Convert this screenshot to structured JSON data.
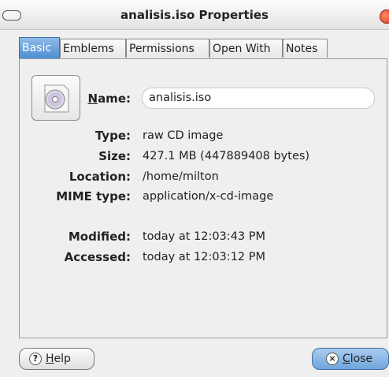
{
  "window": {
    "title": "analisis.iso Properties"
  },
  "tabs": [
    {
      "label": "Basic"
    },
    {
      "label": "Emblems"
    },
    {
      "label": "Permissions"
    },
    {
      "label": "Open With"
    },
    {
      "label": "Notes"
    }
  ],
  "basic": {
    "name_label": "Name:",
    "name_value": "analisis.iso",
    "type_label": "Type:",
    "type_value": "raw CD image",
    "size_label": "Size:",
    "size_value": "427.1 MB (447889408 bytes)",
    "location_label": "Location:",
    "location_value": "/home/milton",
    "mime_label": "MIME type:",
    "mime_value": "application/x-cd-image",
    "modified_label": "Modified:",
    "modified_value": "today at 12:03:43 PM",
    "accessed_label": "Accessed:",
    "accessed_value": "today at 12:03:12 PM"
  },
  "buttons": {
    "help_label": "Help",
    "close_label": "Close"
  },
  "icons": {
    "file": "cd-image-icon",
    "help": "help-icon",
    "close": "close-icon"
  }
}
